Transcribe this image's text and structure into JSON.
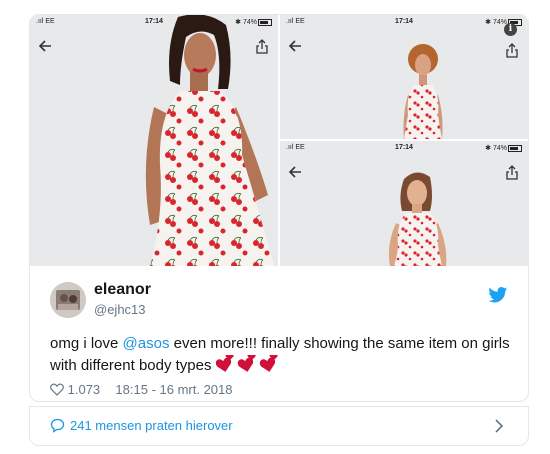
{
  "media": {
    "phone_status": {
      "carrier": ".ııl EE",
      "time": "17:14",
      "battery": "74%"
    },
    "info_symbol": "i"
  },
  "tweet": {
    "display_name": "eleanor",
    "handle": "@ejhc13",
    "text_before": "omg i love ",
    "mention": "@asos",
    "text_after": " even more!!! finally showing the same item on girls with different body types ",
    "likes": "1.073",
    "timestamp": "18:15 - 16 mrt. 2018"
  },
  "footer": {
    "conversation_label": "241 mensen praten hierover"
  },
  "colors": {
    "link_blue": "#1b95e0",
    "twitter_blue": "#1da1f2",
    "heart_red": "#e0245e",
    "text_dark": "#14171a",
    "text_gray": "#657786",
    "border": "#e1e8ed"
  },
  "icons": [
    "back-arrow-icon",
    "share-icon",
    "info-icon",
    "twitter-bird-icon",
    "heart-icon",
    "comment-bubble-icon",
    "chevron-right-icon",
    "heart-emoji-icon"
  ]
}
